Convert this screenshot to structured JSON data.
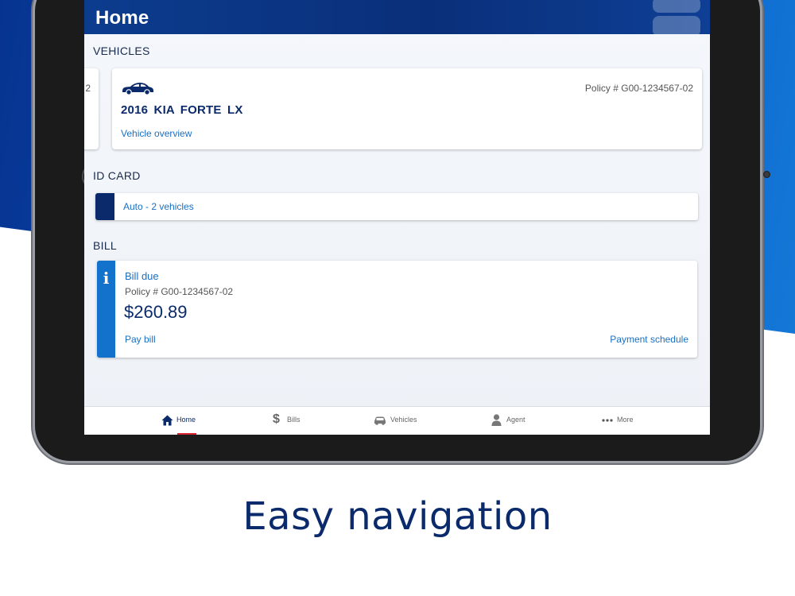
{
  "header": {
    "title": "Home"
  },
  "vehicles": {
    "section_label": "VEHICLES",
    "peek_text": "2",
    "card": {
      "policy": "Policy # G00-1234567-02",
      "name": "2016  KIA FORTE LX",
      "link": "Vehicle overview",
      "icon": "car-icon"
    }
  },
  "id_card": {
    "section_label": "ID CARD",
    "label": "Auto - 2 vehicles"
  },
  "bill": {
    "section_label": "BILL",
    "status": "Bill due",
    "policy": "Policy # G00-1234567-02",
    "amount": "$260.89",
    "pay_link": "Pay bill",
    "schedule_link": "Payment schedule",
    "info_glyph": "i"
  },
  "nav": {
    "items": [
      {
        "label": "Home",
        "icon": "home-icon",
        "active": true
      },
      {
        "label": "Bills",
        "icon": "dollar-icon",
        "active": false
      },
      {
        "label": "Vehicles",
        "icon": "car-icon",
        "active": false
      },
      {
        "label": "Agent",
        "icon": "person-icon",
        "active": false
      },
      {
        "label": "More",
        "icon": "more-icon",
        "active": false
      }
    ]
  },
  "tagline": "Easy navigation",
  "colors": {
    "brand_navy": "#0b2a6b",
    "link_blue": "#1a6fc2",
    "info_blue": "#1372cb",
    "nav_active_underline": "#d9232e"
  }
}
